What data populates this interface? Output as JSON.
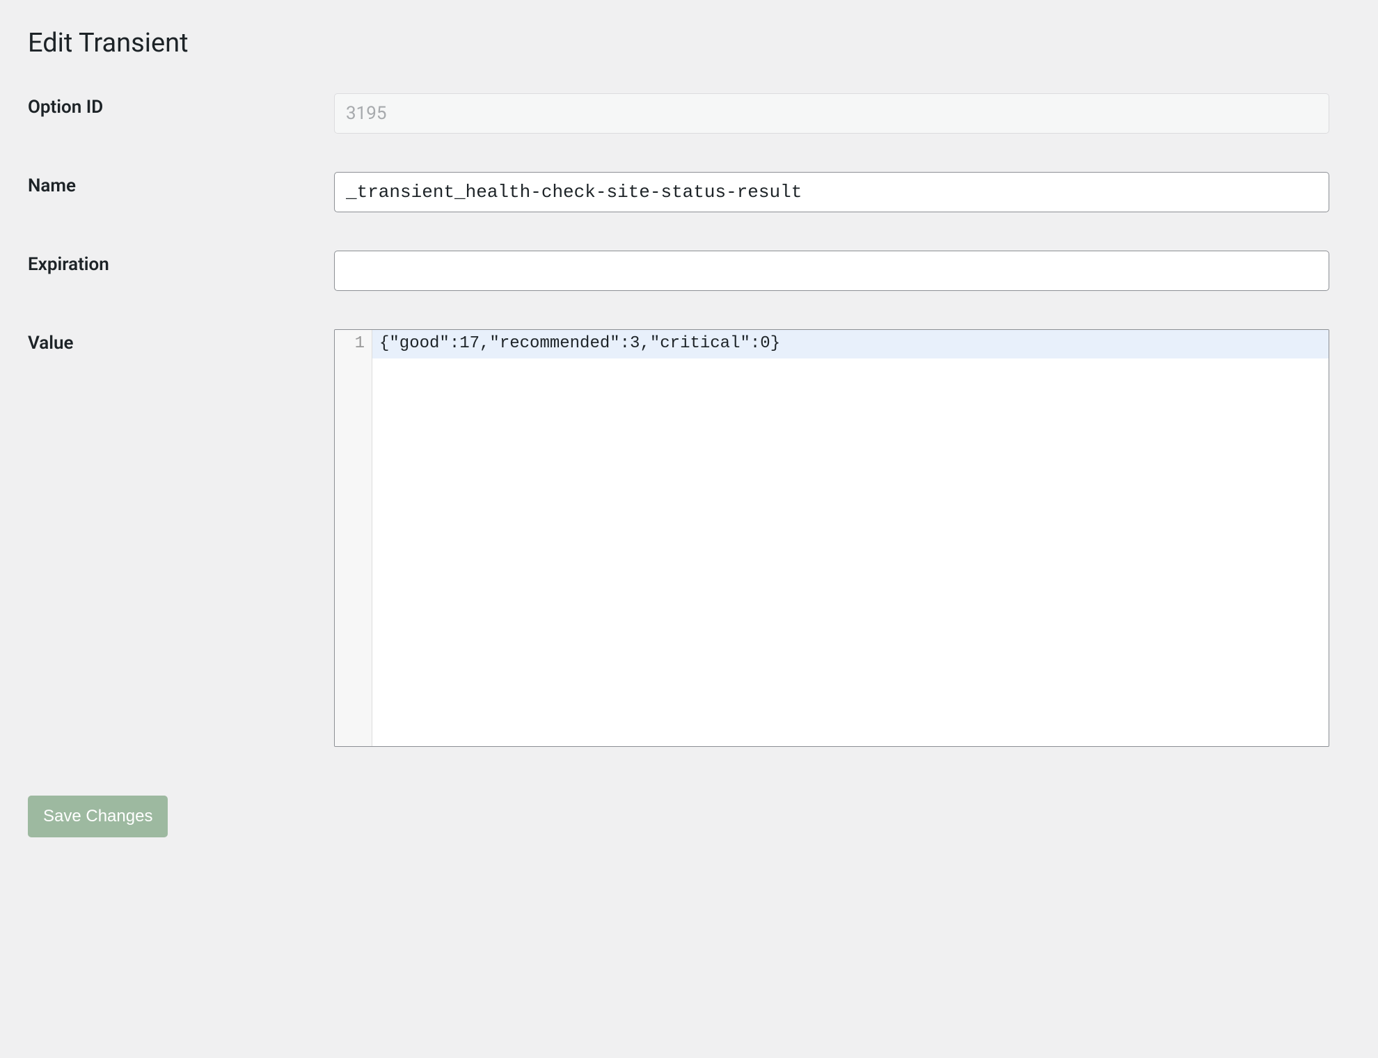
{
  "page": {
    "title": "Edit Transient"
  },
  "fields": {
    "option_id": {
      "label": "Option ID",
      "value": "3195"
    },
    "name": {
      "label": "Name",
      "value": "_transient_health-check-site-status-result"
    },
    "expiration": {
      "label": "Expiration",
      "value": ""
    },
    "value": {
      "label": "Value",
      "line_number": "1",
      "content": "{\"good\":17,\"recommended\":3,\"critical\":0}"
    }
  },
  "actions": {
    "save_label": "Save Changes"
  }
}
